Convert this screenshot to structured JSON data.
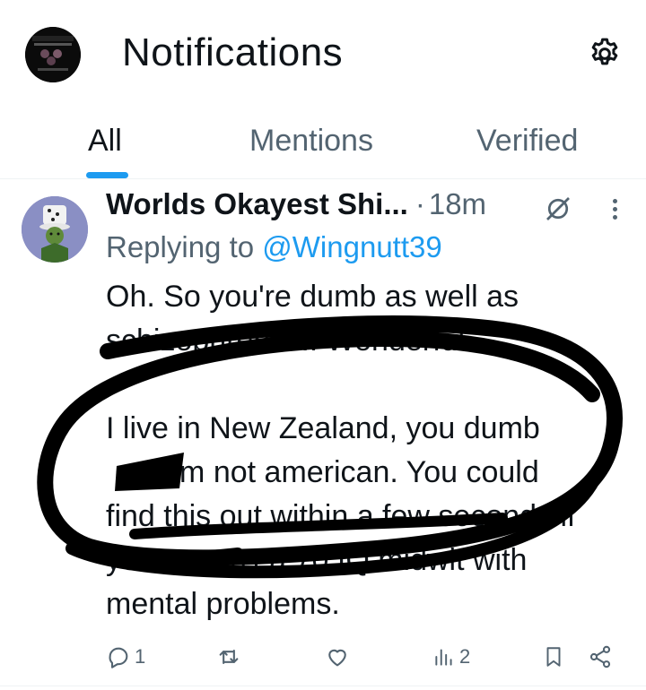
{
  "header": {
    "title": "Notifications",
    "avatar_icon": "profile-avatar-icon",
    "settings_icon": "gear-icon"
  },
  "tabs": [
    {
      "label": "All",
      "active": true
    },
    {
      "label": "Mentions",
      "active": false
    },
    {
      "label": "Verified",
      "active": false
    }
  ],
  "tweet": {
    "display_name": "Worlds Okayest Shi...",
    "separator": "·",
    "time": "18m",
    "replying_prefix": "Replying to",
    "replying_handle": "@Wingnutt39",
    "lines": [
      "Oh. So you're dumb as well as",
      "schizophrenic... Wonderful.",
      "",
      "I live in New Zealand, you dumb",
      "       I'm not american. You could",
      "find this out within a few seconds if",
      "you weren't a 70 IQ midwit with",
      "mental problems."
    ],
    "stats": {
      "replies": "1",
      "views": "2"
    }
  },
  "colors": {
    "accent": "#1d9bf0",
    "text": "#0f1419",
    "muted": "#536471"
  }
}
